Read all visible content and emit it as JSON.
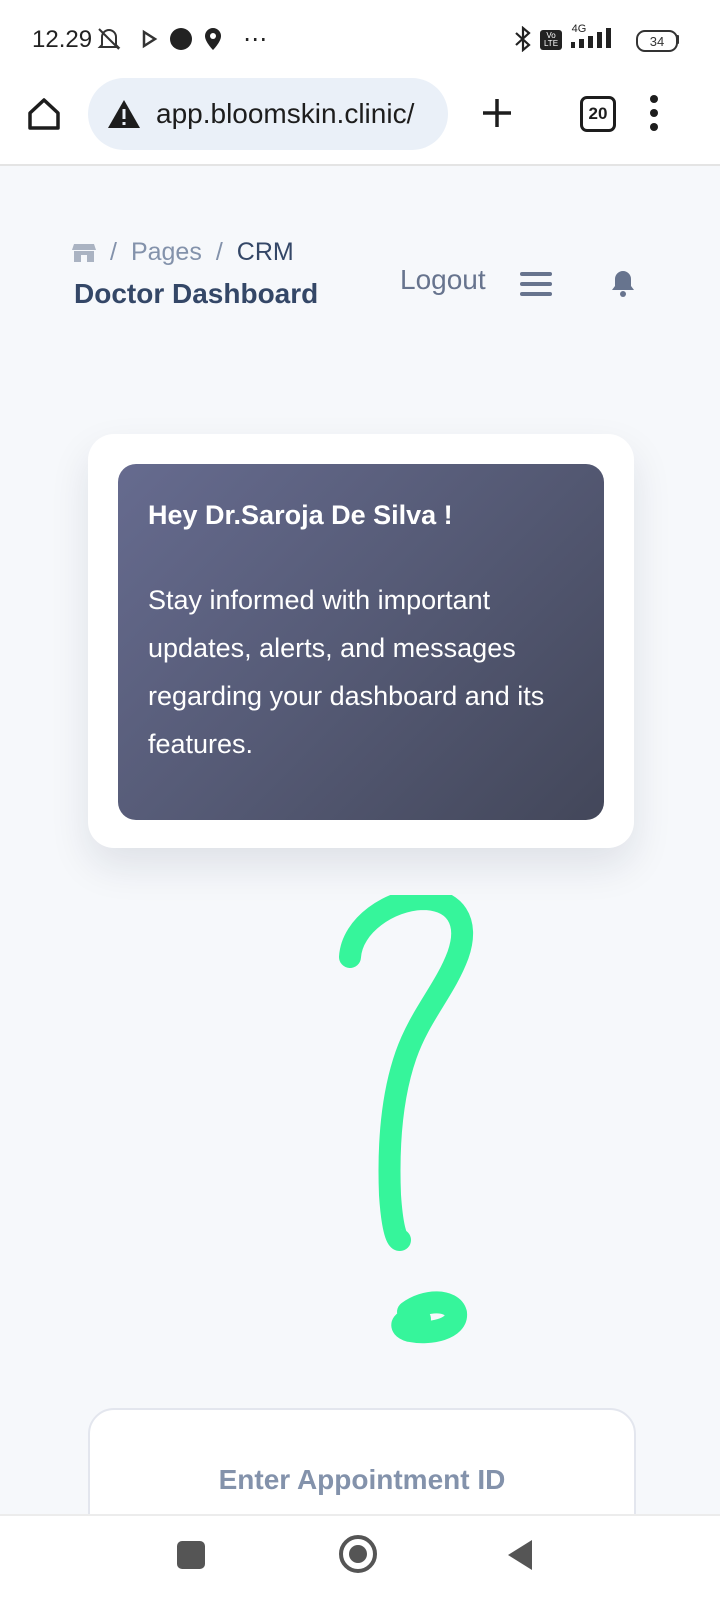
{
  "status_bar": {
    "time": "12.29",
    "battery": "34",
    "network": "4G",
    "volte": "Vo LTE"
  },
  "browser": {
    "url": "app.bloomskin.clinic/",
    "tab_count": "20"
  },
  "header": {
    "breadcrumb": [
      "Pages",
      "CRM"
    ],
    "breadcrumb_separator": "/",
    "title": "Doctor Dashboard",
    "logout_label": "Logout"
  },
  "notice": {
    "greeting": "Hey Dr.Saroja De Silva !",
    "message": "Stay informed with important updates, alerts, and messages regarding your dashboard and its features."
  },
  "appointment": {
    "placeholder": "Enter Appointment ID"
  },
  "colors": {
    "page_bg": "#f6f8fb",
    "text_dark": "#344767",
    "text_muted": "#8392ab",
    "card_gradient_start": "#666b8f",
    "card_gradient_end": "#43475a",
    "doodle": "#36f59b"
  },
  "icons": {
    "home": "home-icon",
    "warning": "warning-icon",
    "new_tab": "plus-icon",
    "menu": "more-vert-icon",
    "breadcrumb_home": "store-icon",
    "hamburger": "hamburger-icon",
    "bell": "bell-icon"
  }
}
